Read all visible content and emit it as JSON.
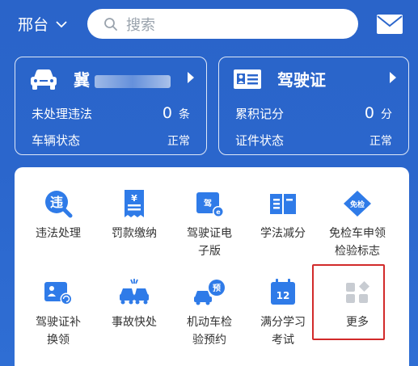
{
  "header": {
    "city": "邢台",
    "search_placeholder": "搜索"
  },
  "vehicle_card": {
    "plate_prefix": "冀",
    "row1_label": "未处理违法",
    "row1_value": "0",
    "row1_unit": "条",
    "row2_label": "车辆状态",
    "row2_value": "正常"
  },
  "license_card": {
    "title": "驾驶证",
    "row1_label": "累积记分",
    "row1_value": "0",
    "row1_unit": "分",
    "row2_label": "证件状态",
    "row2_value": "正常"
  },
  "services": [
    {
      "line1": "违法处理",
      "line2": "",
      "icon": "violation-icon"
    },
    {
      "line1": "罚款缴纳",
      "line2": "",
      "icon": "fine-receipt-icon"
    },
    {
      "line1": "驾驶证电",
      "line2": "子版",
      "icon": "e-license-icon"
    },
    {
      "line1": "学法减分",
      "line2": "",
      "icon": "book-icon"
    },
    {
      "line1": "免检车申领",
      "line2": "检验标志",
      "icon_text": "免检",
      "icon": "exempt-badge-icon"
    },
    {
      "line1": "驾驶证补",
      "line2": "换领",
      "icon": "license-renew-icon"
    },
    {
      "line1": "事故快处",
      "line2": "",
      "icon": "accident-icon"
    },
    {
      "line1": "机动车检",
      "line2": "验预约",
      "icon_text": "预",
      "icon": "inspection-booking-icon"
    },
    {
      "line1": "满分学习",
      "line2": "考试",
      "icon_text": "12",
      "icon": "calendar-12-icon"
    },
    {
      "line1": "更多",
      "line2": "",
      "icon": "more-grid-icon"
    }
  ],
  "colors": {
    "brand_blue": "#2b66cc",
    "icon_blue": "#2f7be8",
    "highlight_red": "#d22a2a"
  }
}
